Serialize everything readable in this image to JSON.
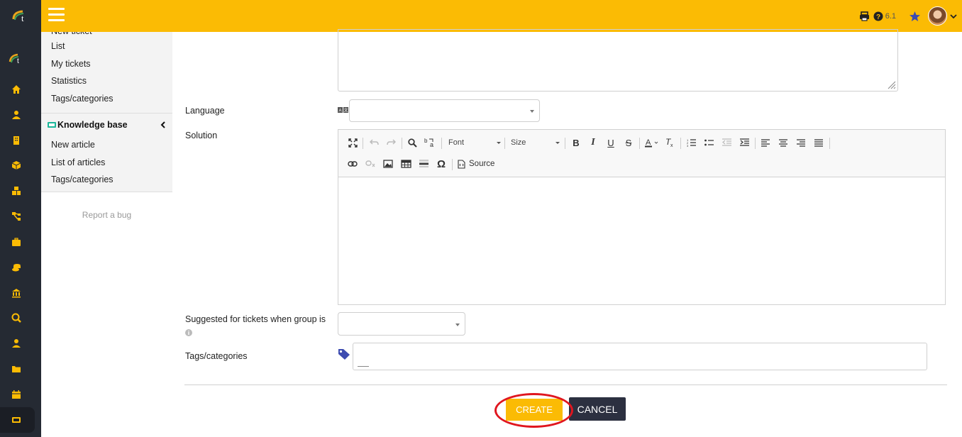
{
  "header": {
    "version": "6.1"
  },
  "menu": {
    "partial_top": "New ticket",
    "ticket_items": [
      "List",
      "My tickets",
      "Statistics",
      "Tags/categories"
    ],
    "kb_header": "Knowledge base",
    "kb_items": [
      "New article",
      "List of articles",
      "Tags/categories"
    ],
    "report_bug": "Report a bug"
  },
  "form": {
    "language_label": "Language",
    "solution_label": "Solution",
    "group_label": "Suggested for tickets when group is",
    "tags_label": "Tags/categories"
  },
  "editor": {
    "font_label": "Font",
    "size_label": "Size",
    "source_label": "Source"
  },
  "buttons": {
    "create": "CREATE",
    "cancel": "CANCEL"
  },
  "colors": {
    "accent": "#fbbb04",
    "sidebar": "#252a33",
    "annotation": "#e0161f"
  }
}
